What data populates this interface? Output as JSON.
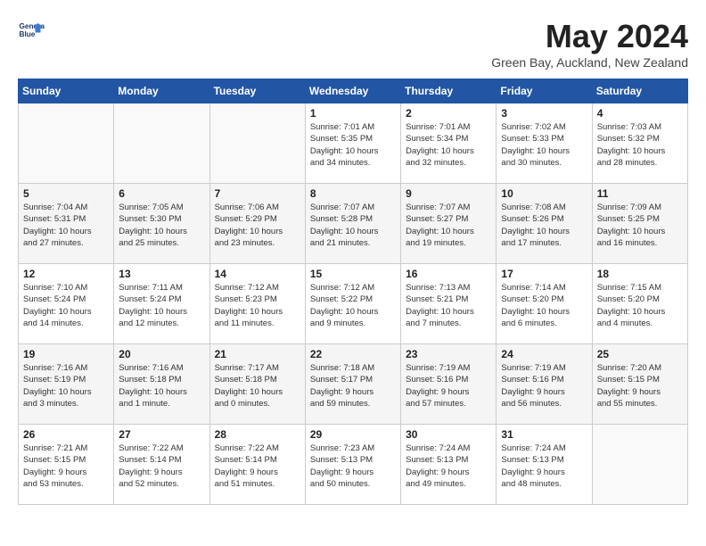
{
  "logo": {
    "line1": "General",
    "line2": "Blue"
  },
  "title": "May 2024",
  "location": "Green Bay, Auckland, New Zealand",
  "weekdays": [
    "Sunday",
    "Monday",
    "Tuesday",
    "Wednesday",
    "Thursday",
    "Friday",
    "Saturday"
  ],
  "weeks": [
    [
      {
        "day": "",
        "info": ""
      },
      {
        "day": "",
        "info": ""
      },
      {
        "day": "",
        "info": ""
      },
      {
        "day": "1",
        "info": "Sunrise: 7:01 AM\nSunset: 5:35 PM\nDaylight: 10 hours\nand 34 minutes."
      },
      {
        "day": "2",
        "info": "Sunrise: 7:01 AM\nSunset: 5:34 PM\nDaylight: 10 hours\nand 32 minutes."
      },
      {
        "day": "3",
        "info": "Sunrise: 7:02 AM\nSunset: 5:33 PM\nDaylight: 10 hours\nand 30 minutes."
      },
      {
        "day": "4",
        "info": "Sunrise: 7:03 AM\nSunset: 5:32 PM\nDaylight: 10 hours\nand 28 minutes."
      }
    ],
    [
      {
        "day": "5",
        "info": "Sunrise: 7:04 AM\nSunset: 5:31 PM\nDaylight: 10 hours\nand 27 minutes."
      },
      {
        "day": "6",
        "info": "Sunrise: 7:05 AM\nSunset: 5:30 PM\nDaylight: 10 hours\nand 25 minutes."
      },
      {
        "day": "7",
        "info": "Sunrise: 7:06 AM\nSunset: 5:29 PM\nDaylight: 10 hours\nand 23 minutes."
      },
      {
        "day": "8",
        "info": "Sunrise: 7:07 AM\nSunset: 5:28 PM\nDaylight: 10 hours\nand 21 minutes."
      },
      {
        "day": "9",
        "info": "Sunrise: 7:07 AM\nSunset: 5:27 PM\nDaylight: 10 hours\nand 19 minutes."
      },
      {
        "day": "10",
        "info": "Sunrise: 7:08 AM\nSunset: 5:26 PM\nDaylight: 10 hours\nand 17 minutes."
      },
      {
        "day": "11",
        "info": "Sunrise: 7:09 AM\nSunset: 5:25 PM\nDaylight: 10 hours\nand 16 minutes."
      }
    ],
    [
      {
        "day": "12",
        "info": "Sunrise: 7:10 AM\nSunset: 5:24 PM\nDaylight: 10 hours\nand 14 minutes."
      },
      {
        "day": "13",
        "info": "Sunrise: 7:11 AM\nSunset: 5:24 PM\nDaylight: 10 hours\nand 12 minutes."
      },
      {
        "day": "14",
        "info": "Sunrise: 7:12 AM\nSunset: 5:23 PM\nDaylight: 10 hours\nand 11 minutes."
      },
      {
        "day": "15",
        "info": "Sunrise: 7:12 AM\nSunset: 5:22 PM\nDaylight: 10 hours\nand 9 minutes."
      },
      {
        "day": "16",
        "info": "Sunrise: 7:13 AM\nSunset: 5:21 PM\nDaylight: 10 hours\nand 7 minutes."
      },
      {
        "day": "17",
        "info": "Sunrise: 7:14 AM\nSunset: 5:20 PM\nDaylight: 10 hours\nand 6 minutes."
      },
      {
        "day": "18",
        "info": "Sunrise: 7:15 AM\nSunset: 5:20 PM\nDaylight: 10 hours\nand 4 minutes."
      }
    ],
    [
      {
        "day": "19",
        "info": "Sunrise: 7:16 AM\nSunset: 5:19 PM\nDaylight: 10 hours\nand 3 minutes."
      },
      {
        "day": "20",
        "info": "Sunrise: 7:16 AM\nSunset: 5:18 PM\nDaylight: 10 hours\nand 1 minute."
      },
      {
        "day": "21",
        "info": "Sunrise: 7:17 AM\nSunset: 5:18 PM\nDaylight: 10 hours\nand 0 minutes."
      },
      {
        "day": "22",
        "info": "Sunrise: 7:18 AM\nSunset: 5:17 PM\nDaylight: 9 hours\nand 59 minutes."
      },
      {
        "day": "23",
        "info": "Sunrise: 7:19 AM\nSunset: 5:16 PM\nDaylight: 9 hours\nand 57 minutes."
      },
      {
        "day": "24",
        "info": "Sunrise: 7:19 AM\nSunset: 5:16 PM\nDaylight: 9 hours\nand 56 minutes."
      },
      {
        "day": "25",
        "info": "Sunrise: 7:20 AM\nSunset: 5:15 PM\nDaylight: 9 hours\nand 55 minutes."
      }
    ],
    [
      {
        "day": "26",
        "info": "Sunrise: 7:21 AM\nSunset: 5:15 PM\nDaylight: 9 hours\nand 53 minutes."
      },
      {
        "day": "27",
        "info": "Sunrise: 7:22 AM\nSunset: 5:14 PM\nDaylight: 9 hours\nand 52 minutes."
      },
      {
        "day": "28",
        "info": "Sunrise: 7:22 AM\nSunset: 5:14 PM\nDaylight: 9 hours\nand 51 minutes."
      },
      {
        "day": "29",
        "info": "Sunrise: 7:23 AM\nSunset: 5:13 PM\nDaylight: 9 hours\nand 50 minutes."
      },
      {
        "day": "30",
        "info": "Sunrise: 7:24 AM\nSunset: 5:13 PM\nDaylight: 9 hours\nand 49 minutes."
      },
      {
        "day": "31",
        "info": "Sunrise: 7:24 AM\nSunset: 5:13 PM\nDaylight: 9 hours\nand 48 minutes."
      },
      {
        "day": "",
        "info": ""
      }
    ]
  ]
}
